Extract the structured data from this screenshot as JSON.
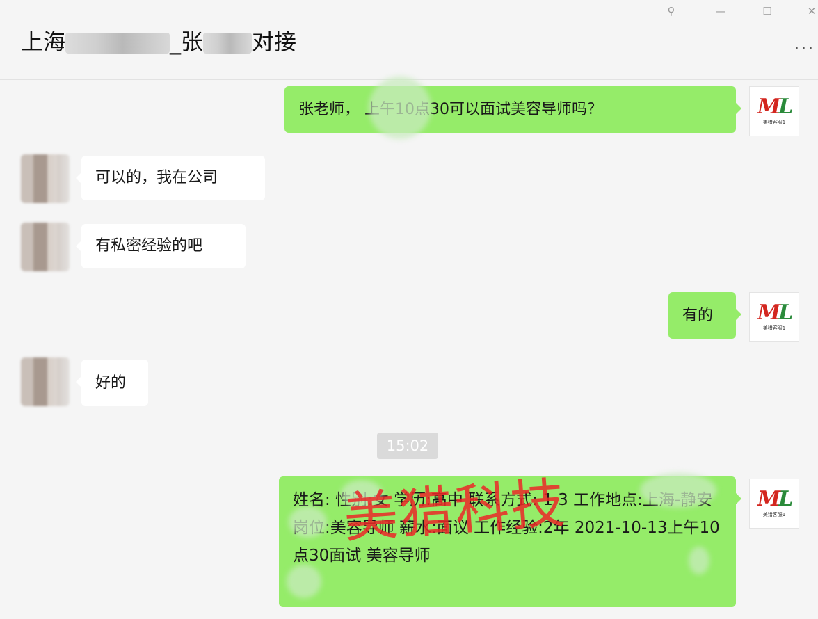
{
  "window": {
    "title_prefix": "上海",
    "title_mid": "_张",
    "title_suffix": "对接",
    "pin_icon": "pin-icon",
    "min_icon": "minimize-icon",
    "max_icon": "maximize-icon",
    "close_icon": "close-icon",
    "more_icon": "more-icon"
  },
  "messages": [
    {
      "side": "me",
      "text": "张老师，    上午10点30可以面试美容导师吗？"
    },
    {
      "side": "them",
      "text": "可以的，我在公司"
    },
    {
      "side": "them",
      "text": "有私密经验的吧"
    },
    {
      "side": "me",
      "text": "有的"
    },
    {
      "side": "them",
      "text": "好的"
    }
  ],
  "timestamp": "15:02",
  "card": {
    "text": "姓名:     性别:女 学历:高中 联系方式: 1          3      工作地点:上海-静安 岗位:美容导师 薪水:面议 工作经验:2年 2021-10-13上午10点30面试    美容导师"
  },
  "logo": {
    "mark": "ML",
    "sub": "美猎客服1"
  },
  "watermark": "美猎科技",
  "colors": {
    "me_bubble": "#95ec69",
    "them_bubble": "#ffffff",
    "background": "#f5f5f5",
    "watermark": "#e82828"
  }
}
